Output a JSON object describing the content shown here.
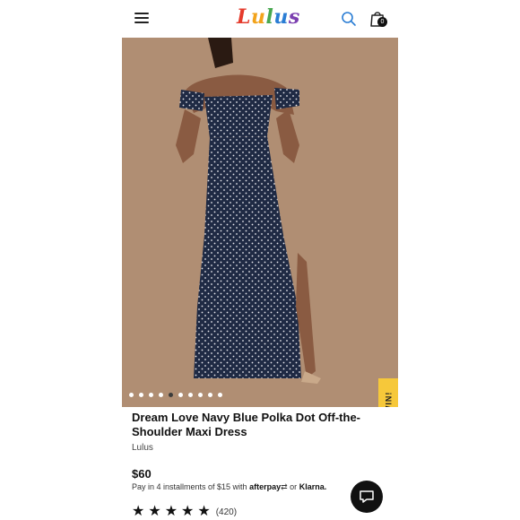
{
  "header": {
    "logo_text": "Lulus",
    "bag_count": "0",
    "icons": [
      "menu-icon",
      "search-icon",
      "shopping-bag-icon"
    ]
  },
  "gallery": {
    "image_count": 10,
    "active_index": 4
  },
  "promo": {
    "spin_label": "SPIN TO WIN!"
  },
  "product": {
    "title": "Dream Love Navy Blue Polka Dot Off-the-Shoulder Maxi Dress",
    "brand": "Lulus",
    "price": "$60",
    "installments": "Pay in 4 installments of $15 with",
    "afterpay": "afterpay",
    "or_text": "or",
    "klarna": "Klarna.",
    "rating": 5,
    "review_count": "(420)"
  },
  "colors": {
    "accent_yellow": "#f6c83a",
    "hero_bg": "#b08e73",
    "dress_navy": "#1f2a44"
  }
}
